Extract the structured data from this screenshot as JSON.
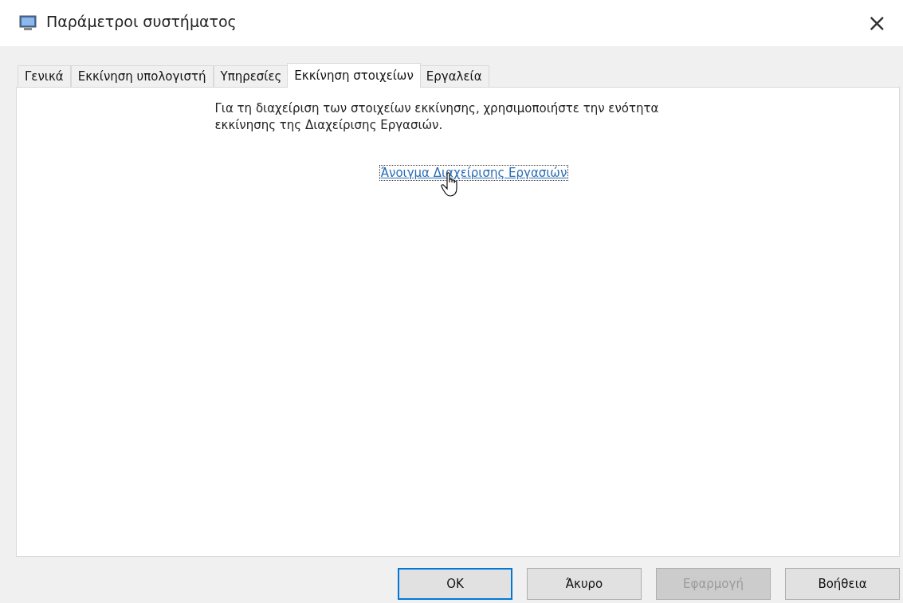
{
  "window": {
    "title": "Παράμετροι συστήματος",
    "close": "×"
  },
  "tabs": [
    {
      "label": "Γενικά",
      "selected": false
    },
    {
      "label": "Εκκίνηση υπολογιστή",
      "selected": false
    },
    {
      "label": "Υπηρεσίες",
      "selected": false
    },
    {
      "label": "Εκκίνηση στοιχείων",
      "selected": true
    },
    {
      "label": "Εργαλεία",
      "selected": false
    }
  ],
  "panel": {
    "message": "Για τη διαχείριση των στοιχείων εκκίνησης, χρησιμοποιήστε την ενότητα εκκίνησης της Διαχείρισης Εργασιών.",
    "link": "Άνοιγμα Διαχείρισης Εργασιών",
    "link_focused": true
  },
  "buttons": [
    {
      "label": "OK",
      "default": true,
      "disabled": false
    },
    {
      "label": "Άκυρο",
      "default": false,
      "disabled": false
    },
    {
      "label": "Εφαρμογή",
      "default": false,
      "disabled": true
    },
    {
      "label": "Βοήθεια",
      "default": false,
      "disabled": false
    }
  ]
}
